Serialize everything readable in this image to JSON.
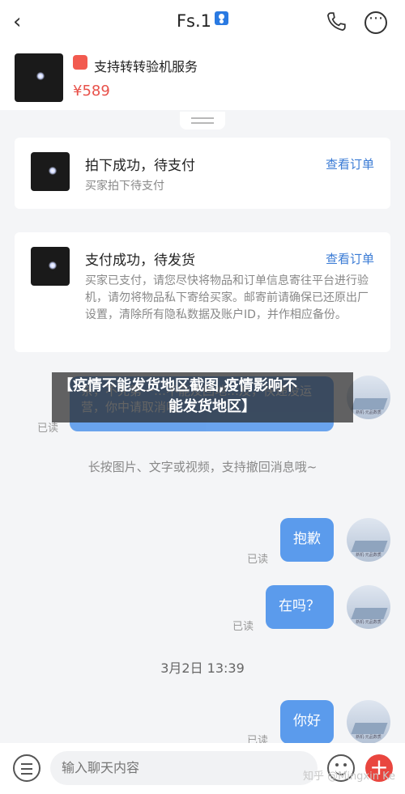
{
  "header": {
    "back_icon": "‹",
    "title": "Fs.1",
    "more_icon": "⋯"
  },
  "product": {
    "service_label": "支持转转验机服务",
    "price": "¥589"
  },
  "orders": [
    {
      "title": "拍下成功，待支付",
      "link": "查看订单",
      "subtitle": "买家拍下待支付"
    },
    {
      "title": "支付成功，待发货",
      "link": "查看订单",
      "subtitle": "买家已支付，请您尽快将物品和订单信息寄往平台进行验机，请勿将物品私下寄给买家。邮寄前请确保已还原出厂设置，清除所有隐私数据及账户ID，并作相应备份。"
    }
  ],
  "chat": {
    "partial_bubble": "亲，不充第一…不能及回地…及，快递没运营，你中请取消吧",
    "partial_read": "已读",
    "system_hint": "长按图片、文字或视频，支持撤回消息哦~",
    "messages": [
      {
        "text": "抱歉",
        "status": "已读"
      },
      {
        "text": "在吗？",
        "status": "已读"
      }
    ],
    "date": "3月2日 13:39",
    "last_message": {
      "text": "你好",
      "status": "已读"
    }
  },
  "overlay": {
    "line1": "【疫情不能发货地区截图,疫情影响不",
    "line2": "能发货地区】"
  },
  "input": {
    "placeholder": "输入聊天内容",
    "plus_icon": "+"
  },
  "watermark": "知乎 @Mingxin Ke"
}
